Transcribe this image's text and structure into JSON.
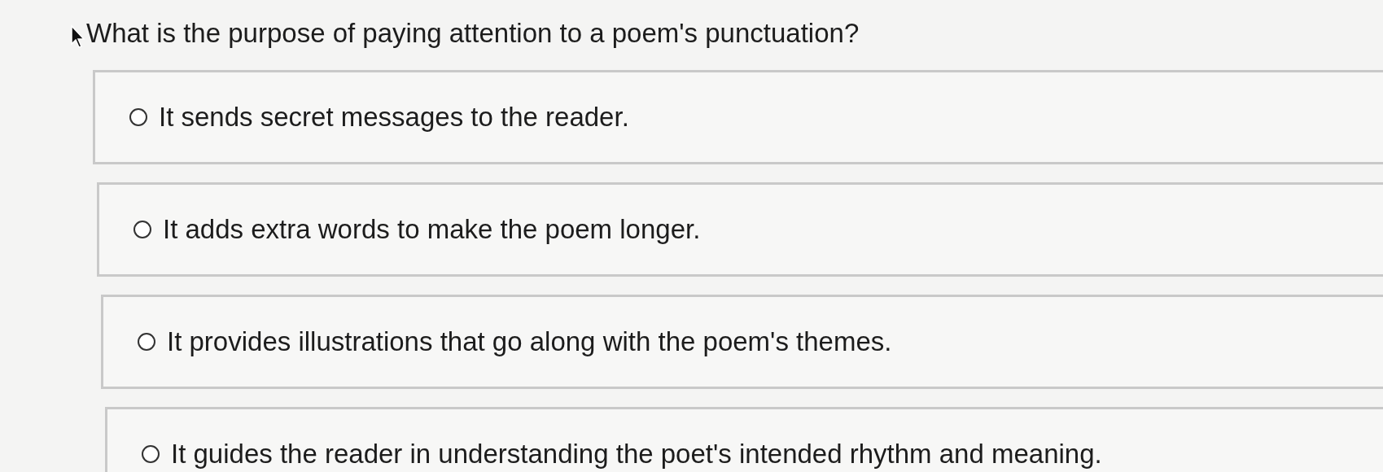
{
  "question": "What is the purpose of paying attention to a poem's punctuation?",
  "options": [
    {
      "label": "It sends secret messages to the reader.",
      "selected": false
    },
    {
      "label": "It adds extra words to make the poem longer.",
      "selected": false
    },
    {
      "label": "It provides illustrations that go along with the poem's themes.",
      "selected": false
    },
    {
      "label": "It guides the reader in understanding the poet's intended rhythm and meaning.",
      "selected": false
    }
  ]
}
